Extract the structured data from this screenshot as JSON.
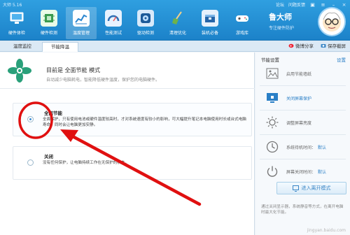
{
  "app": {
    "title": "大师 5.16"
  },
  "window_links": {
    "forum": "论坛",
    "feedback": "问题反馈"
  },
  "toolbar": [
    {
      "label": "硬件体检",
      "icon": "monitor-icon",
      "color": "#ffffff",
      "active": false
    },
    {
      "label": "硬件检测",
      "icon": "chip-icon",
      "color": "#3a9b4f",
      "active": false
    },
    {
      "label": "温度管理",
      "icon": "thermometer-chart-icon",
      "color": "#ffffff",
      "active": true
    },
    {
      "label": "性能测试",
      "icon": "speedometer-icon",
      "color": "#2f6fb5",
      "active": false
    },
    {
      "label": "驱动检测",
      "icon": "gear-shield-icon",
      "color": "#1d5a99",
      "active": false
    },
    {
      "label": "清理优化",
      "icon": "broom-icon",
      "color": "#4f8d2f",
      "active": false
    },
    {
      "label": "装机必备",
      "icon": "box-icon",
      "color": "#2565a8",
      "active": false
    },
    {
      "label": "游戏库",
      "icon": "gamepad-icon",
      "color": "#ffffff",
      "active": false
    }
  ],
  "master": {
    "name": "鲁大师",
    "subtitle": "专注硬件防护"
  },
  "tabs": [
    {
      "label": "温度监控",
      "active": false
    },
    {
      "label": "节能降温",
      "active": true
    }
  ],
  "tab_actions": {
    "share": "微博分享",
    "save": "保存截屏"
  },
  "mode": {
    "title": "目前是 全面节能 模式",
    "desc": "自动减少电脑耗电，智能降低硬件温度，保护您的电脑硬件。"
  },
  "options": [
    {
      "title": "全面节能",
      "desc": "全面保护，只有使用电池或硬件温度较高时，才对系统速度有较小的影响，可大幅提升笔记本电脑使用时长或台式电脑寿命，同时会让电脑更加安静。",
      "selected": true
    },
    {
      "title": "关闭",
      "desc": "没有任何保护，让电脑持续工作在无保护的状态。",
      "selected": false
    }
  ],
  "side": {
    "heading": "节能设置",
    "settings_link": "设置",
    "rows": [
      {
        "icon": "image-icon",
        "text": "启用节能墙纸",
        "value": "",
        "blue": false
      },
      {
        "icon": "screen-lock-icon",
        "text": "关闭屏幕保护",
        "value": "",
        "blue": true
      },
      {
        "icon": "brightness-icon",
        "text": "调整屏幕亮度",
        "value": "",
        "blue": false
      },
      {
        "icon": "clock-icon",
        "text": "系统待机时间：",
        "value": "默认",
        "blue": false
      },
      {
        "icon": "power-icon",
        "text": "屏幕关闭时间：",
        "value": "默认",
        "blue": false
      }
    ],
    "leave_button": "进入离开模式",
    "note": "通过关闭显示器，系统静音等方式，在离开电脑时最大化节能。"
  },
  "watermark": "jingyan.baidu.com",
  "annotation": {
    "color": "#e01010"
  }
}
